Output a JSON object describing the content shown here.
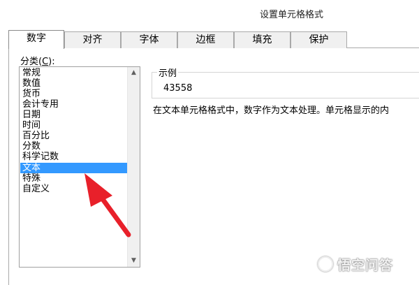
{
  "window": {
    "title": "设置单元格格式"
  },
  "tabs": [
    {
      "label": "数字",
      "active": true
    },
    {
      "label": "对齐"
    },
    {
      "label": "字体"
    },
    {
      "label": "边框"
    },
    {
      "label": "填充"
    },
    {
      "label": "保护"
    }
  ],
  "category": {
    "label_prefix": "分类(",
    "label_hotkey": "C",
    "label_suffix": "):",
    "items": [
      "常规",
      "数值",
      "货币",
      "会计专用",
      "日期",
      "时间",
      "百分比",
      "分数",
      "科学记数",
      "文本",
      "特殊",
      "自定义"
    ],
    "selected": "文本"
  },
  "sample": {
    "legend": "示例",
    "value": "43558"
  },
  "description": "在文本单元格格式中，数字作为文本处理。单元格显示的内",
  "annotation": {
    "arrow_color": "#e8202a"
  },
  "colors": {
    "selection": "#3399ff"
  },
  "watermark": {
    "text": "悟空问答"
  }
}
